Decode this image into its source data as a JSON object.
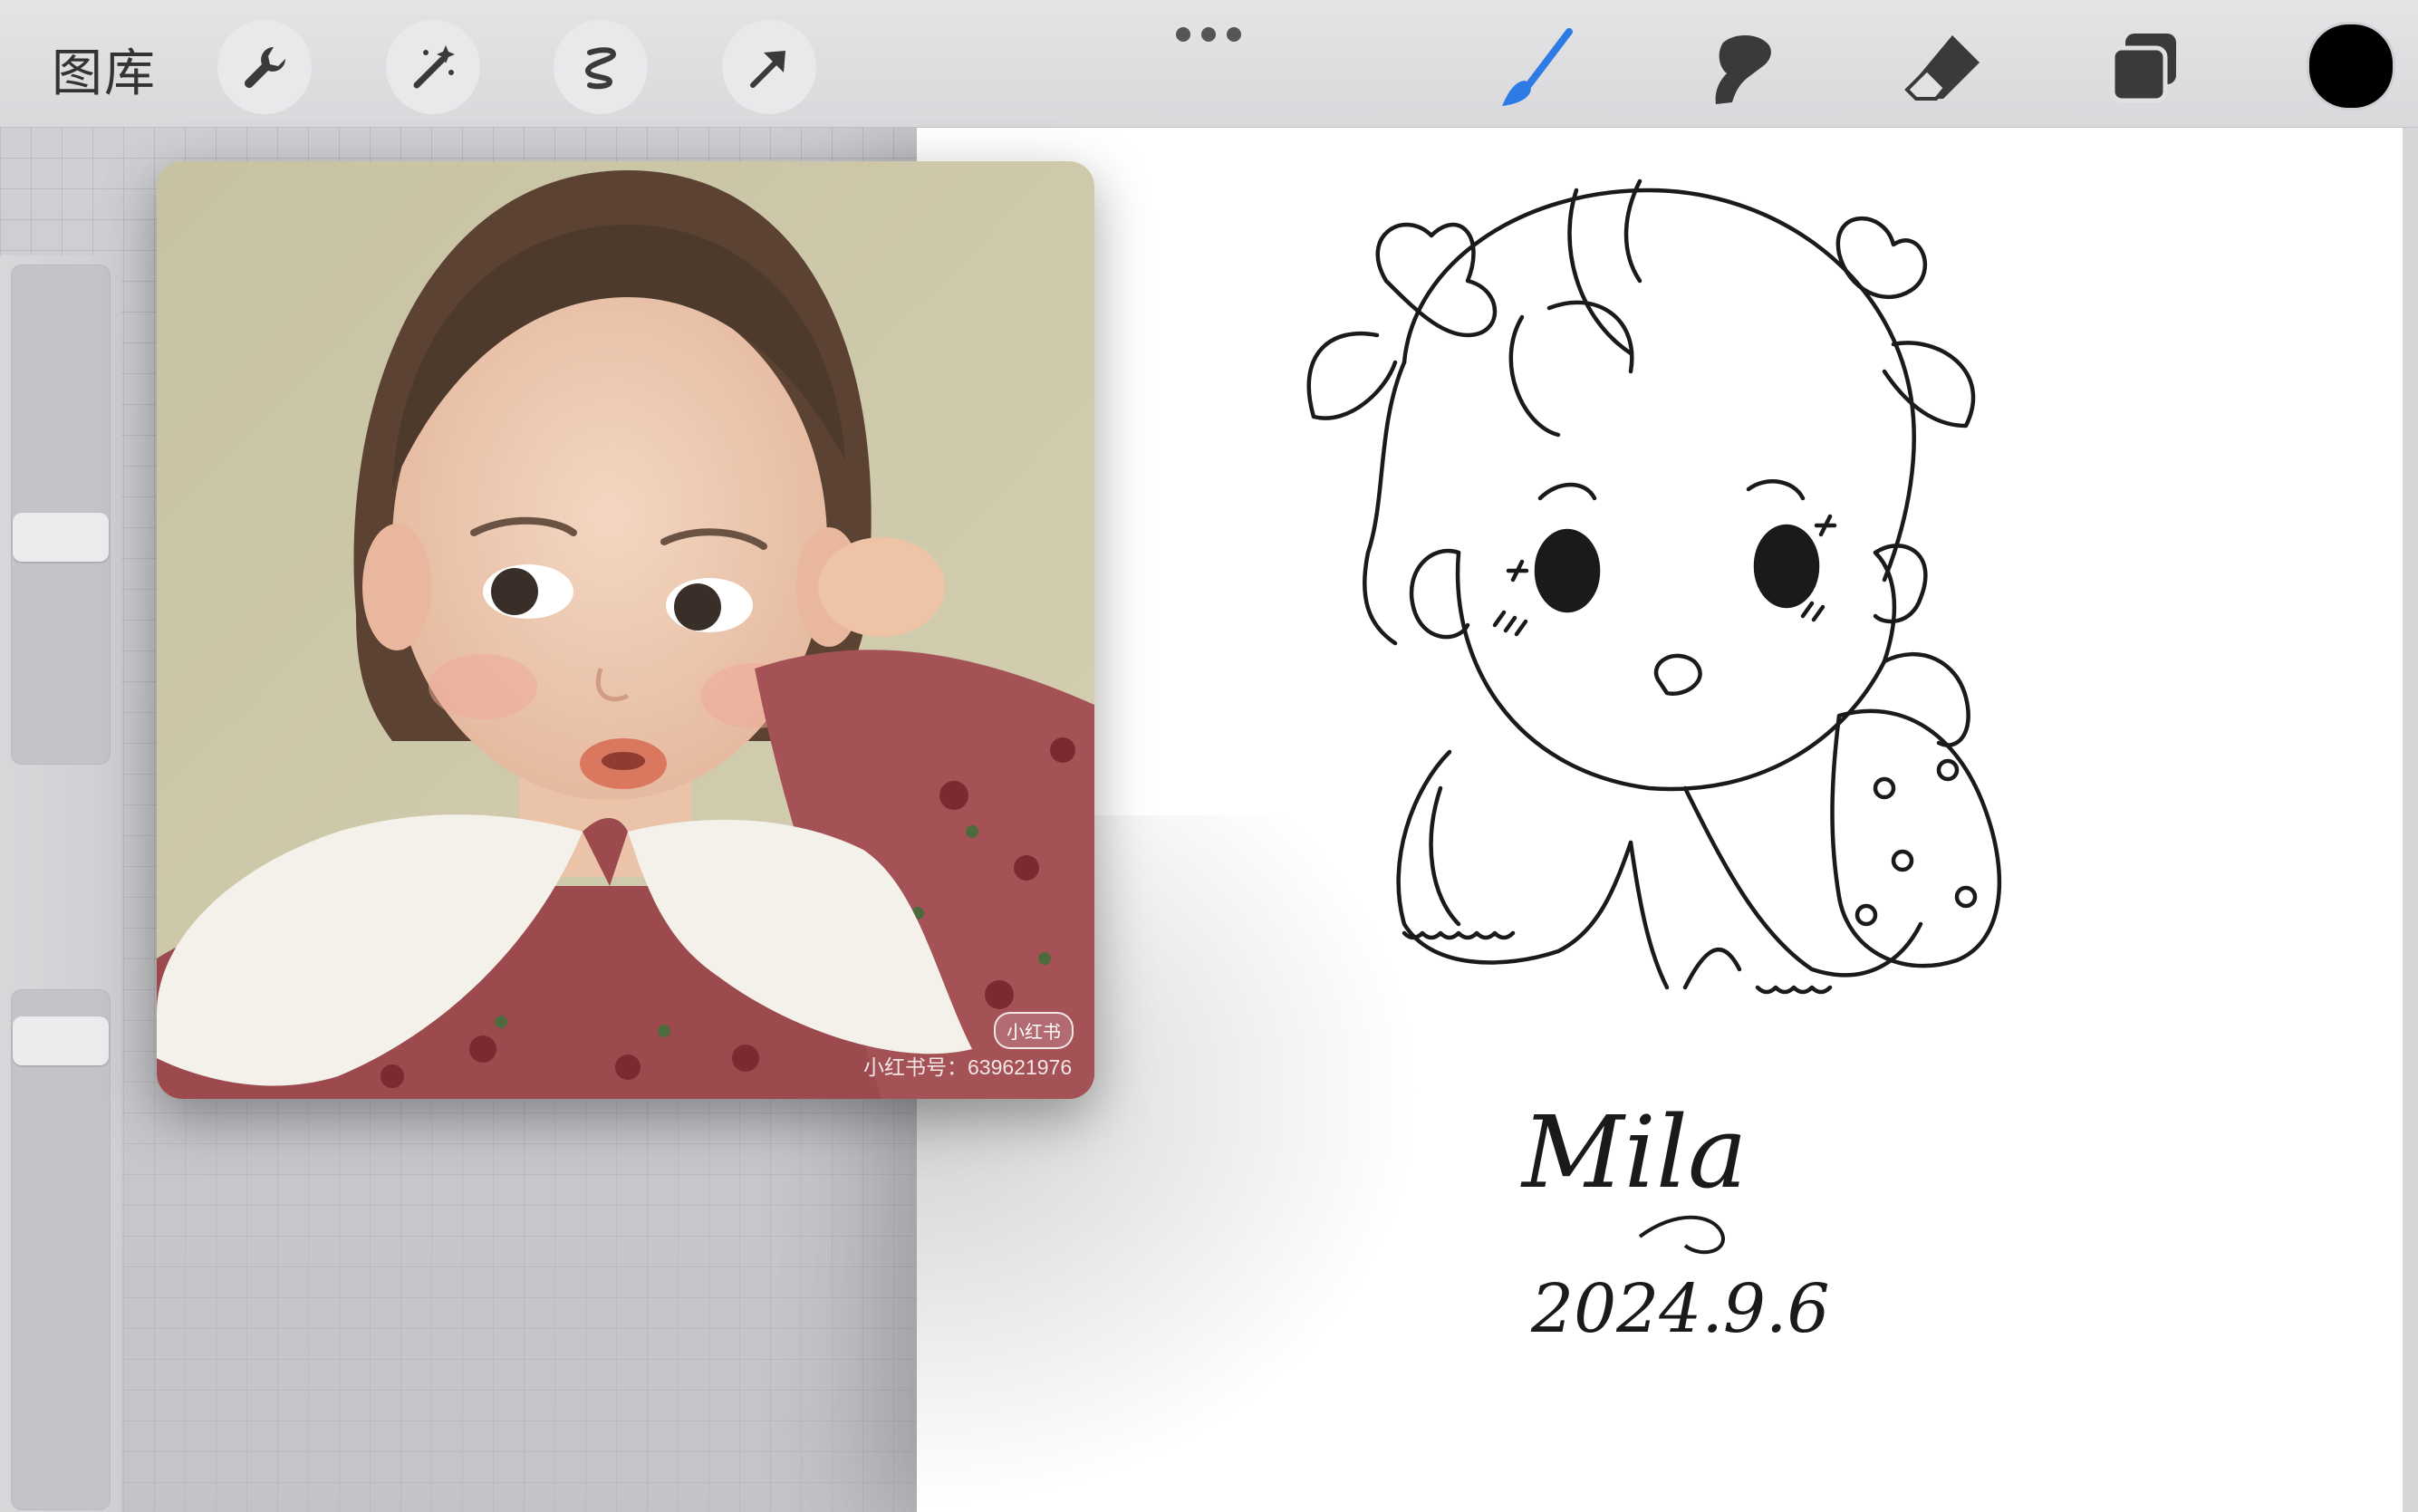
{
  "toolbar": {
    "gallery_label": "图库",
    "left_tools": [
      "wrench-icon",
      "magic-wand-icon",
      "selection-icon",
      "transform-arrow-icon"
    ],
    "right_tools": [
      "brush-icon",
      "smudge-icon",
      "eraser-icon",
      "layers-icon"
    ],
    "active_tool": "brush-icon",
    "accent_color": "#2f7be6",
    "current_color": "#000000"
  },
  "sidebar": {
    "brush_size_level": 0.45,
    "opacity_level": 0.95
  },
  "reference": {
    "caption": "小红书号：639621976",
    "logo_text": "小红书"
  },
  "drawing": {
    "signature": "Mila",
    "date": "2024.9.6"
  }
}
